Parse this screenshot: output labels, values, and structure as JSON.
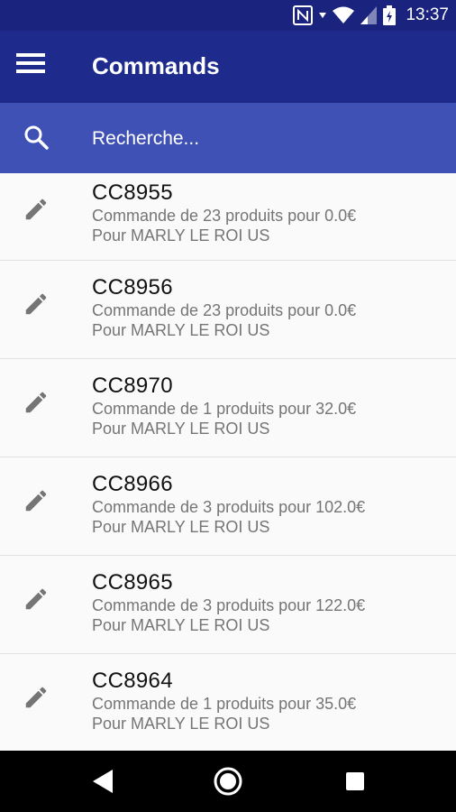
{
  "status_bar": {
    "time": "13:37",
    "icons": [
      "nfc-icon",
      "wifi-icon",
      "signal-icon",
      "battery-charging-icon"
    ]
  },
  "app_bar": {
    "title": "Commands",
    "menu_icon": "hamburger-menu-icon"
  },
  "search": {
    "placeholder": "Recherche...",
    "value": "",
    "icon": "search-icon"
  },
  "commands": [
    {
      "code": "CC8955",
      "description": "Commande de 23 produits pour 0.0€",
      "destination": "Pour MARLY LE ROI US"
    },
    {
      "code": "CC8956",
      "description": "Commande de 23 produits pour 0.0€",
      "destination": "Pour MARLY LE ROI US"
    },
    {
      "code": "CC8970",
      "description": "Commande de 1 produits pour 32.0€",
      "destination": "Pour MARLY LE ROI US"
    },
    {
      "code": "CC8966",
      "description": "Commande de 3 produits pour 102.0€",
      "destination": "Pour MARLY LE ROI US"
    },
    {
      "code": "CC8965",
      "description": "Commande de 3 produits pour 122.0€",
      "destination": "Pour MARLY LE ROI US"
    },
    {
      "code": "CC8964",
      "description": "Commande de 1 produits pour 35.0€",
      "destination": "Pour MARLY LE ROI US"
    }
  ],
  "nav_bar": {
    "icons": [
      "back-icon",
      "home-icon",
      "recents-icon"
    ]
  },
  "colors": {
    "status_bar": "#1a237e",
    "app_bar": "#1f2b8c",
    "search_bar": "#3f51b5",
    "list_background": "#fafafa",
    "nav_bar": "#000000"
  }
}
